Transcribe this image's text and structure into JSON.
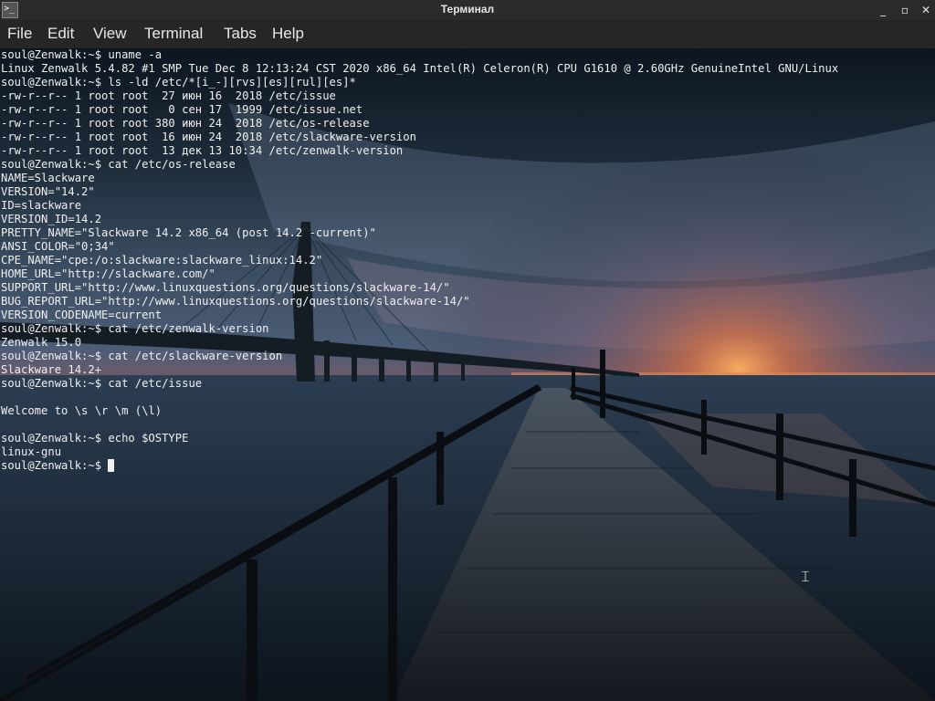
{
  "window": {
    "title": "Терминал",
    "app_icon": "terminal-icon",
    "app_icon_glyph": ">_",
    "buttons": {
      "minimize": "_",
      "maximize": "▫",
      "close": "✕"
    }
  },
  "menu": {
    "items": [
      "File",
      "Edit",
      "View",
      "Terminal",
      "Tabs",
      "Help"
    ]
  },
  "terminal": {
    "lines": [
      "soul@Zenwalk:~$ uname -a",
      "Linux Zenwalk 5.4.82 #1 SMP Tue Dec 8 12:13:24 CST 2020 x86_64 Intel(R) Celeron(R) CPU G1610 @ 2.60GHz GenuineIntel GNU/Linux",
      "soul@Zenwalk:~$ ls -ld /etc/*[i_-][rvs][es][rul][es]*",
      "-rw-r--r-- 1 root root  27 июн 16  2018 /etc/issue",
      "-rw-r--r-- 1 root root   0 сен 17  1999 /etc/issue.net",
      "-rw-r--r-- 1 root root 380 июн 24  2018 /etc/os-release",
      "-rw-r--r-- 1 root root  16 июн 24  2018 /etc/slackware-version",
      "-rw-r--r-- 1 root root  13 дек 13 10:34 /etc/zenwalk-version",
      "soul@Zenwalk:~$ cat /etc/os-release",
      "NAME=Slackware",
      "VERSION=\"14.2\"",
      "ID=slackware",
      "VERSION_ID=14.2",
      "PRETTY_NAME=\"Slackware 14.2 x86_64 (post 14.2 -current)\"",
      "ANSI_COLOR=\"0;34\"",
      "CPE_NAME=\"cpe:/o:slackware:slackware_linux:14.2\"",
      "HOME_URL=\"http://slackware.com/\"",
      "SUPPORT_URL=\"http://www.linuxquestions.org/questions/slackware-14/\"",
      "BUG_REPORT_URL=\"http://www.linuxquestions.org/questions/slackware-14/\"",
      "VERSION_CODENAME=current",
      "soul@Zenwalk:~$ cat /etc/zenwalk-version",
      "Zenwalk 15.0",
      "soul@Zenwalk:~$ cat /etc/slackware-version",
      "Slackware 14.2+",
      "soul@Zenwalk:~$ cat /etc/issue",
      "",
      "Welcome to \\s \\r \\m (\\l)",
      "",
      "soul@Zenwalk:~$ echo $OSTYPE",
      "linux-gnu",
      "soul@Zenwalk:~$ "
    ],
    "text_color": "#f0f0f0",
    "mouse_cursor_icon": "ibeam-cursor-icon"
  }
}
